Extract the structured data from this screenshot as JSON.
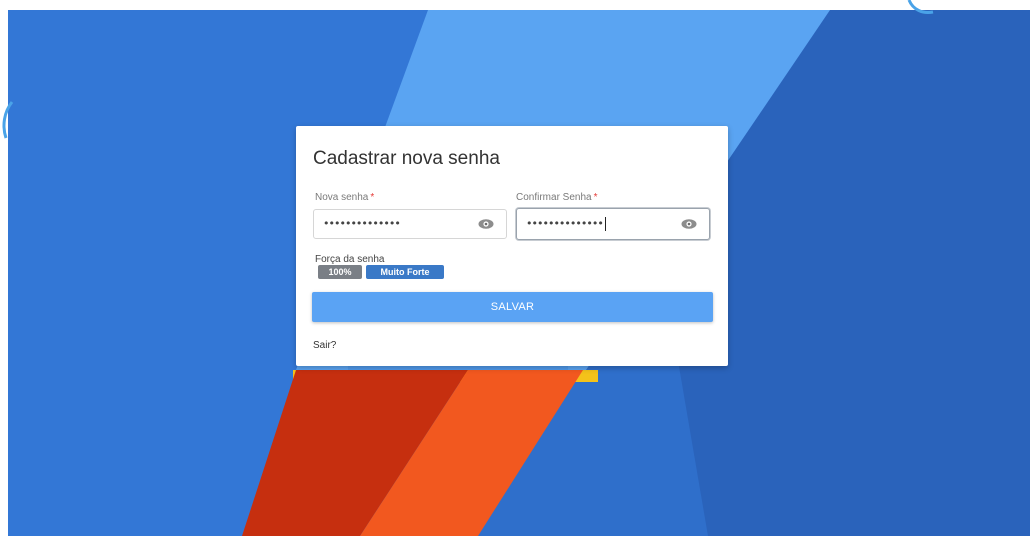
{
  "form": {
    "title": "Cadastrar nova senha",
    "new_password": {
      "label": "Nova senha",
      "required_mark": "*",
      "masked_value": "••••••••••••••"
    },
    "confirm_password": {
      "label": "Confirmar Senha",
      "required_mark": "*",
      "masked_value": "••••••••••••••"
    },
    "strength": {
      "label": "Força da senha",
      "percent_badge": "100%",
      "level_badge": "Muito Forte",
      "percent_value": 100
    },
    "save_button": "SALVAR",
    "exit_link": "Sair?"
  },
  "icons": {
    "show_password": "eye-icon"
  },
  "colors": {
    "background_blue": "#2f6fcb",
    "light_blue_stripe": "#5aa4f2",
    "red_stripe": "#c62f0f",
    "orange_stripe": "#f2581f",
    "yellow_accent": "#f4c21a",
    "button": "#5aa3f4",
    "badge_gray": "#7a7f86",
    "badge_blue": "#3a79c7",
    "required_asterisk": "#e53935"
  }
}
